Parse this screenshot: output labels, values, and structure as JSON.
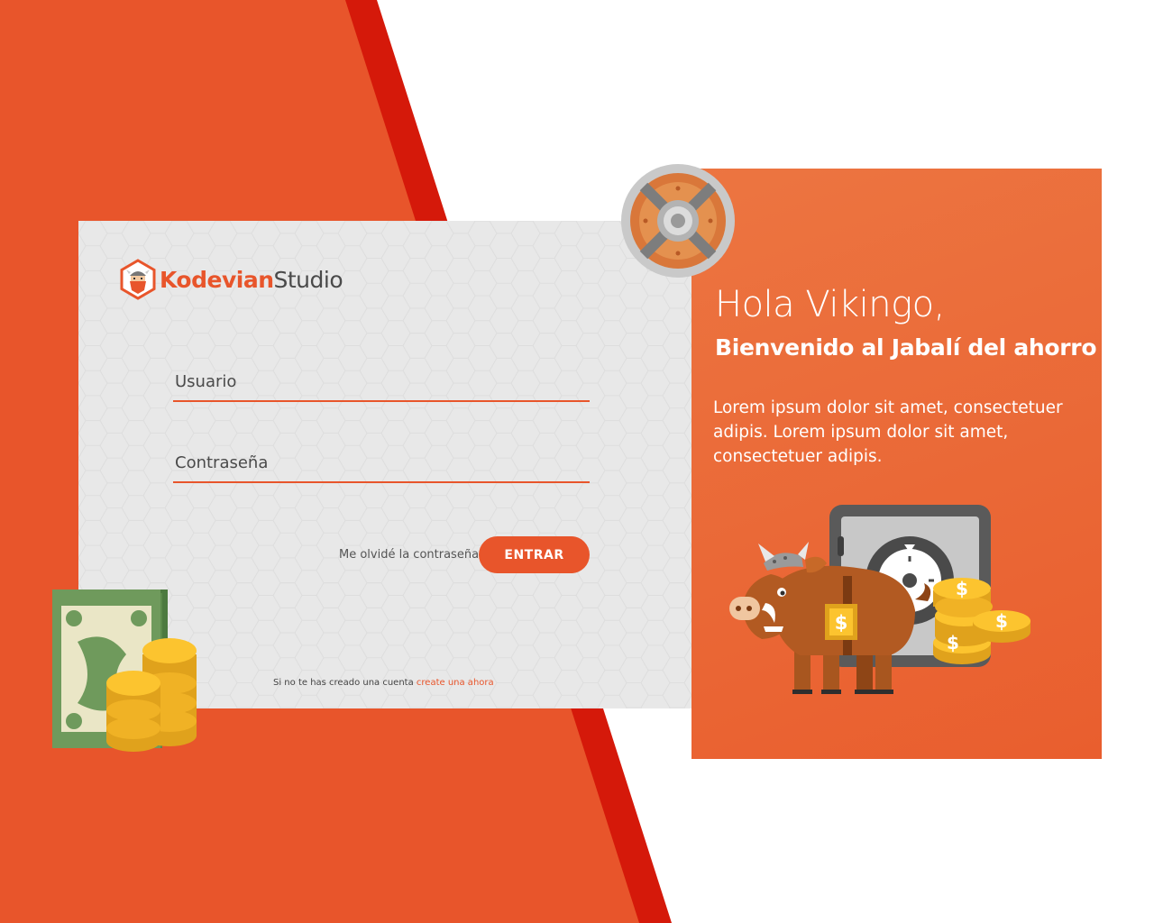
{
  "brand": {
    "name_part1": "Kodevian",
    "name_part2": "Studio",
    "logo_icon": "viking-hexagon-icon"
  },
  "login": {
    "username_label": "Usuario",
    "password_label": "Contraseña",
    "forgot_label": "Me olvidé la contraseña",
    "submit_label": "ENTRAR",
    "signup_prefix": "Si no te has creado una cuenta",
    "signup_link": "create una ahora"
  },
  "welcome": {
    "greeting": "Hola Vikingo,",
    "subtitle": "Bienvenido al Jabalí del ahorro",
    "body": "Lorem ipsum dolor sit amet, consectetuer adipis. Lorem ipsum dolor sit amet, consectetuer adipis."
  },
  "illustrations": {
    "shield": "viking-shield-icon",
    "money": "banknotes-coins-icon",
    "safe": "safe-icon",
    "boar": "viking-boar-icon",
    "coins": "coin-stacks-icon",
    "dollar_sign": "$"
  },
  "colors": {
    "primary": "#e8552b",
    "accent_red": "#d5190a",
    "panel": "#eb6a37",
    "card": "#e8e8e8",
    "text_dark": "#4a4a4a",
    "white": "#ffffff"
  }
}
